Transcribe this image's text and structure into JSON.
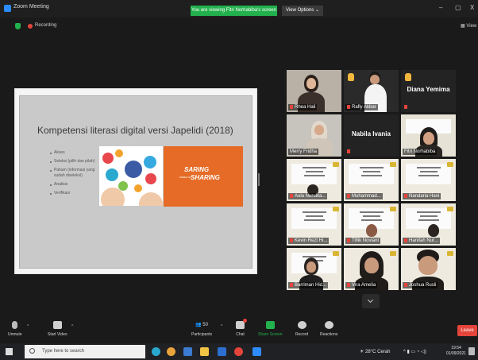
{
  "window": {
    "title": "Zoom Meeting",
    "share_banner": "You are viewing Fitri Norhabiba's screen",
    "view_options": "View Options ⌄",
    "minimize": "–",
    "maximize": "▢",
    "close": "X"
  },
  "status": {
    "recording": "Recording",
    "view": "View"
  },
  "slide": {
    "title": "Kompetensi literasi digital versi Japelidi (2018)",
    "bullets": [
      "Akses",
      "Seleksi (pilih dan pilah)",
      "Paham (informasi yang sudah diseleksi)",
      "Analisis",
      "Verifikasi"
    ],
    "saring_small": "SEBELUM",
    "saring_top": "SARING",
    "saring_bottom": "SHARING"
  },
  "participants": [
    {
      "name": "Rhea Hali",
      "muted": true,
      "type": "video"
    },
    {
      "name": "Rafly Akbar",
      "muted": true,
      "type": "video",
      "hand": true
    },
    {
      "name": "Diana Yemima",
      "muted": true,
      "type": "name",
      "hand": true
    },
    {
      "name": "Merry Fridha",
      "muted": false,
      "type": "video"
    },
    {
      "name": "Nabila Ivania",
      "muted": true,
      "type": "name"
    },
    {
      "name": "Fitri Norhabiba",
      "muted": false,
      "type": "video",
      "active": true
    },
    {
      "name": "Aula Nurulita...",
      "muted": true,
      "type": "doc"
    },
    {
      "name": "Muhammad...",
      "muted": true,
      "type": "doc"
    },
    {
      "name": "Nandaria Hani",
      "muted": true,
      "type": "doc"
    },
    {
      "name": "Kevin Rezt Hi...",
      "muted": true,
      "type": "doc"
    },
    {
      "name": "Tiflik Noviant",
      "muted": true,
      "type": "doc"
    },
    {
      "name": "Hanifah Nur...",
      "muted": true,
      "type": "doc"
    },
    {
      "name": "Barriman Hid...",
      "muted": true,
      "type": "doc"
    },
    {
      "name": "Vira Amelia",
      "muted": true,
      "type": "doc"
    },
    {
      "name": "Joshua Rusli",
      "muted": true,
      "type": "doc"
    }
  ],
  "controls": {
    "unmute": "Unmute",
    "start_video": "Start Video",
    "participants": "Participants",
    "participants_count": "50",
    "chat": "Chat",
    "share_screen": "Share Screen",
    "record": "Record",
    "reactions": "Reactions",
    "leave": "Leave"
  },
  "taskbar": {
    "search_placeholder": "Type here to search",
    "weather": "28°C  Cerah",
    "time": "19:54",
    "date": "01/09/2021"
  },
  "colors": {
    "zoom_blue": "#2d8cff",
    "share_green": "#23b14d",
    "leave_red": "#e5443b",
    "active_speaker": "#e9e22a",
    "saring_orange": "#e56b26"
  }
}
